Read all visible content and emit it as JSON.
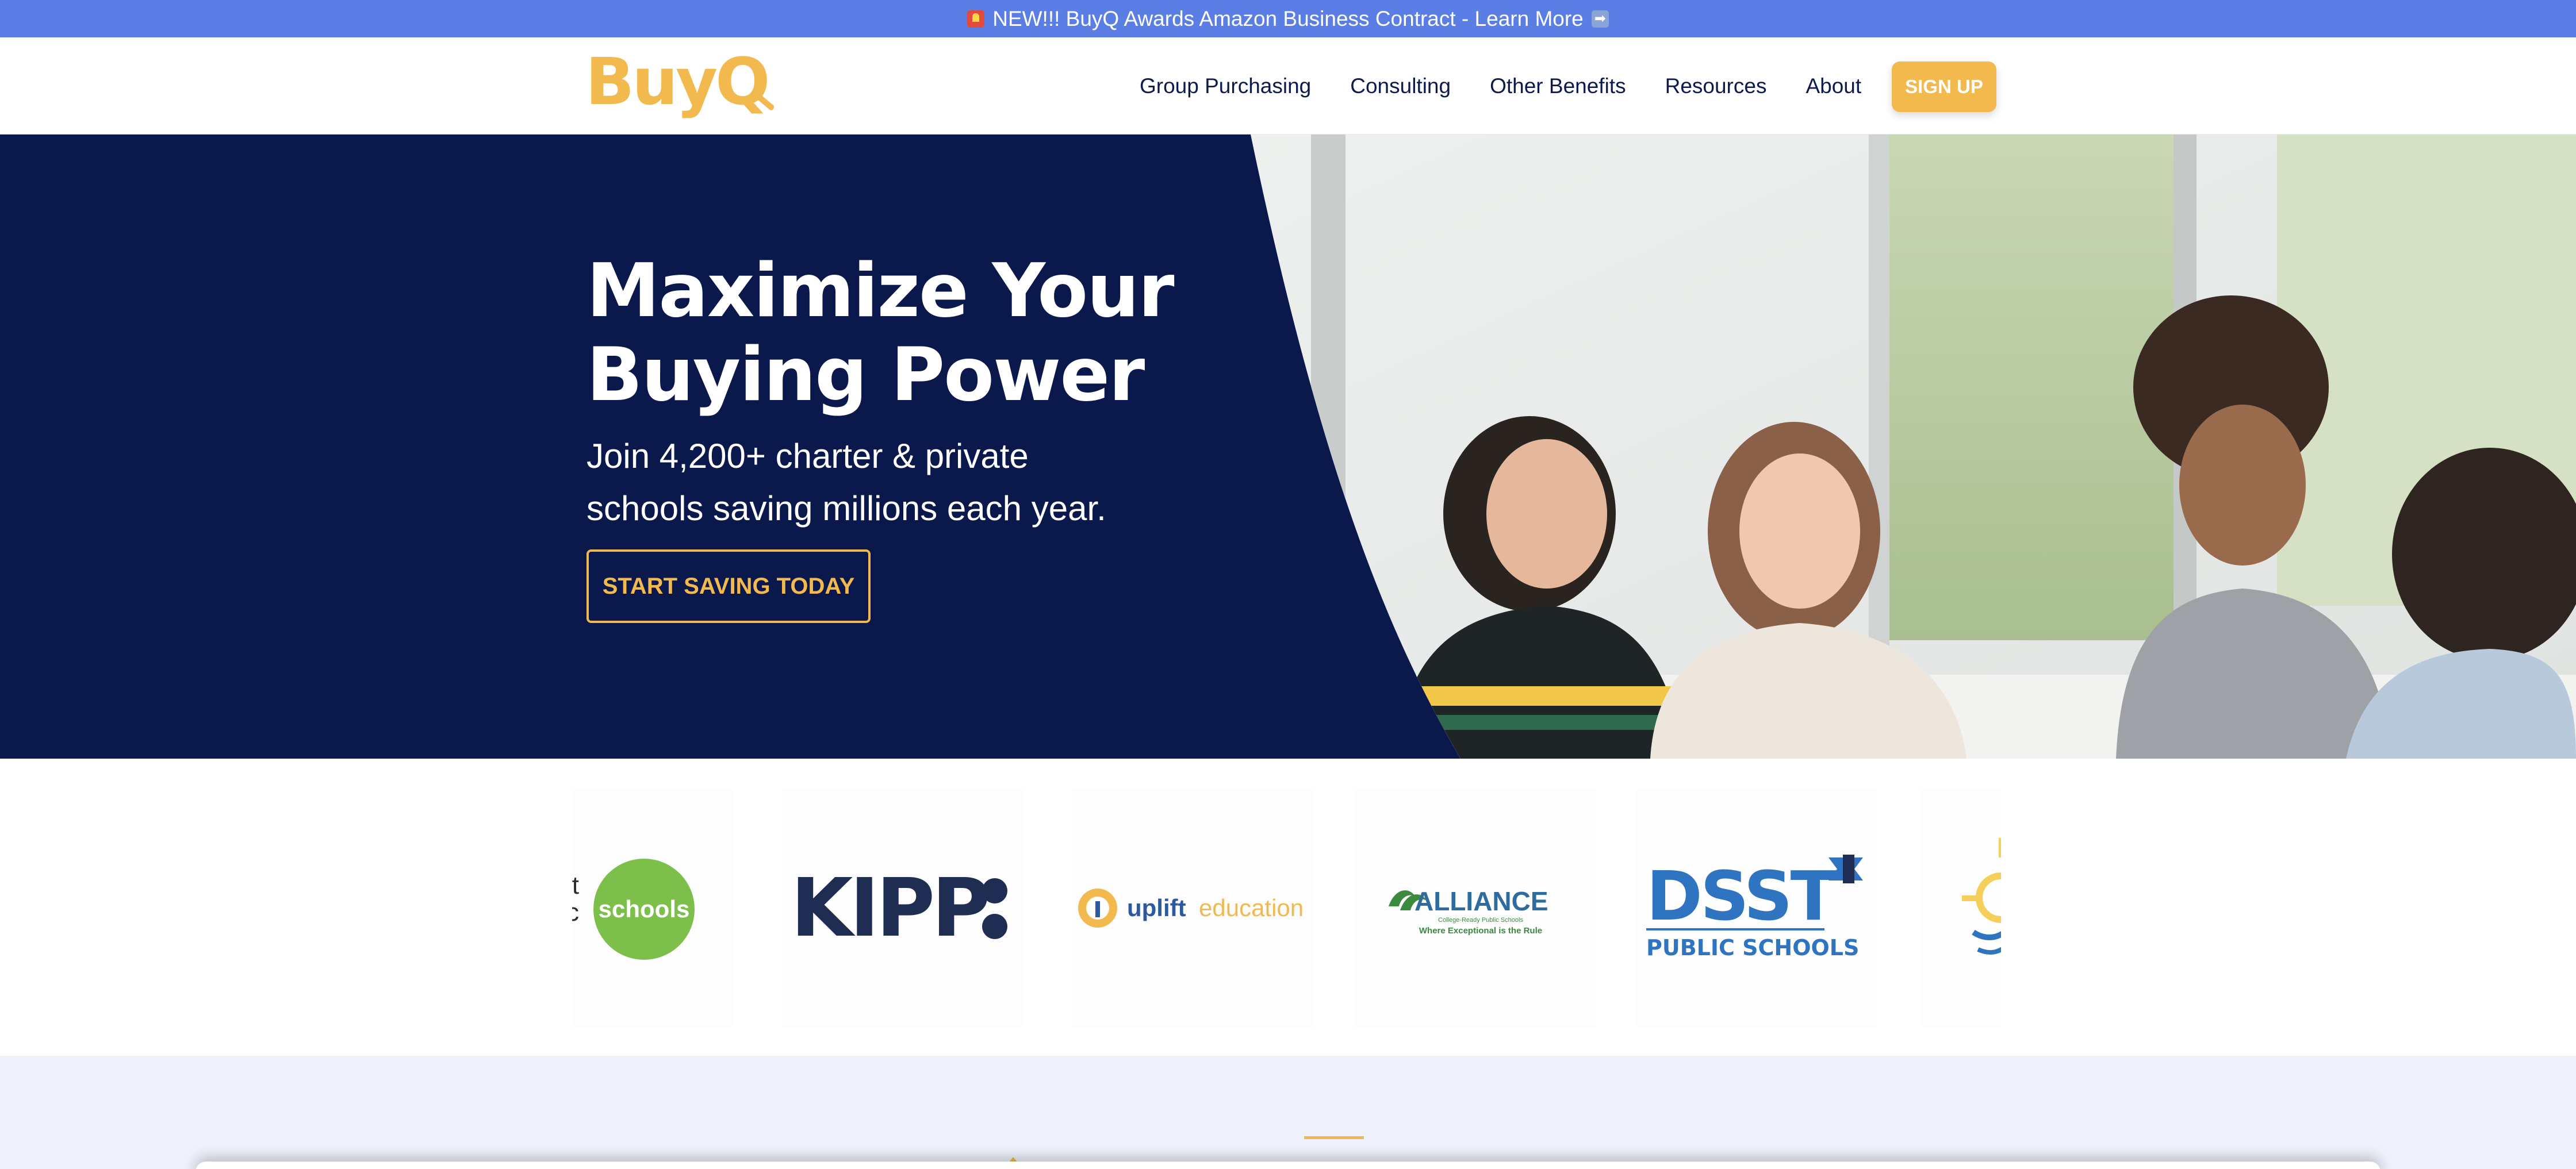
{
  "announcement": {
    "text": "NEW!!! BuyQ Awards Amazon Business Contract - Learn More",
    "lead_icon": "siren-icon",
    "trail_icon": "right-arrow-icon"
  },
  "header": {
    "logo": "BuyQ",
    "nav": [
      "Group Purchasing",
      "Consulting",
      "Other Benefits",
      "Resources",
      "About"
    ],
    "signup_label": "SIGN UP"
  },
  "hero": {
    "title_line1": "Maximize Your",
    "title_line2": "Buying Power",
    "subtitle_line1": "Join 4,200+ charter & private",
    "subtitle_line2": "schools saving millions each year.",
    "cta_label": "START SAVING TODAY"
  },
  "partners": {
    "green_dot_partial_1": "Dot",
    "green_dot_partial_2": "ublic",
    "green_dot_circle": "schools",
    "kipp": "KIPP",
    "uplift_a": "uplift",
    "uplift_b": "education",
    "alliance": "ALLIANCE",
    "alliance_sub": "College-Ready Public Schools",
    "alliance_tag": "Where Exceptional is the Rule",
    "dsst": "DSST",
    "dsst_sub": "PUBLIC SCHOOLS"
  },
  "colors": {
    "announce_bg": "#5b7ee5",
    "brand_gold": "#f2b94e",
    "navy": "#0b184c",
    "nav_text": "#0d1b4c",
    "section_bg": "#eff2fb"
  }
}
